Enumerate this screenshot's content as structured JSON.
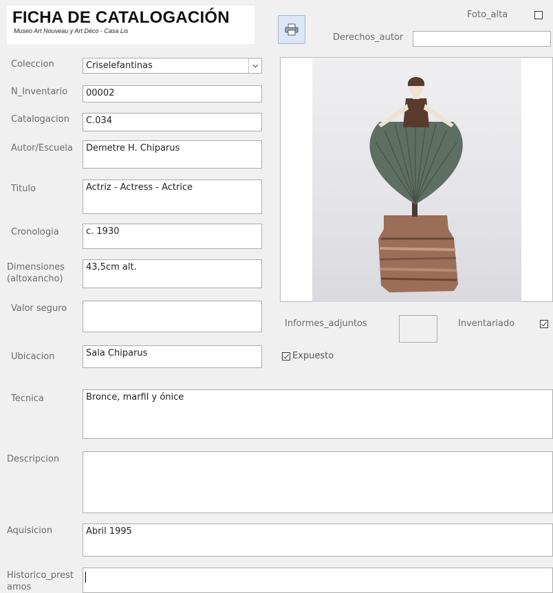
{
  "header": {
    "title": "FICHA DE CATALOGACIÓN",
    "subtitle": "Museo Art Nouveau y Art Déco - Casa Lis"
  },
  "toolbar": {
    "print_icon": "printer-icon"
  },
  "top_right": {
    "foto_alta_label": "Foto_alta",
    "foto_alta_checked": false,
    "derechos_autor_label": "Derechos_autor",
    "derechos_autor_value": ""
  },
  "fields": {
    "coleccion": {
      "label": "Coleccion",
      "value": "Criselefantinas"
    },
    "n_inventario": {
      "label": "N_Inventario",
      "value": "00002"
    },
    "catalogacion": {
      "label": "Catalogacion",
      "value": "C.034"
    },
    "autor": {
      "label": "Autor/Escuela",
      "value": "Demetre H. Chiparus"
    },
    "titulo": {
      "label": "Titulo",
      "value": "Actriz - Actress - Actrice"
    },
    "cronologia": {
      "label": "Cronologia",
      "value": "c. 1930"
    },
    "dimensiones": {
      "label": "Dimensiones (altoxancho)",
      "value": "43,5cm alt."
    },
    "valor_seguro": {
      "label": "Valor seguro",
      "value": ""
    },
    "ubicacion": {
      "label": "Ubicacion",
      "value": "Sala Chiparus"
    },
    "tecnica": {
      "label": "Tecnica",
      "value": "Bronce, marfil y ónice"
    },
    "descripcion": {
      "label": "Descripcion",
      "value": ""
    },
    "aquisicion": {
      "label": "Aquisicion",
      "value": "Abril 1995"
    },
    "historico": {
      "label": "Historico_prestamos",
      "value": ""
    }
  },
  "checks": {
    "informes_adjuntos_label": "Informes_adjuntos",
    "inventariado_label": "Inventariado",
    "inventariado_checked": true,
    "expuesto_label": "Expuesto",
    "expuesto_checked": true
  },
  "colors": {
    "background": "#f0f0f0",
    "field_border": "#ababab",
    "label": "#6b6b6b",
    "button_bg": "#dce6f4"
  }
}
